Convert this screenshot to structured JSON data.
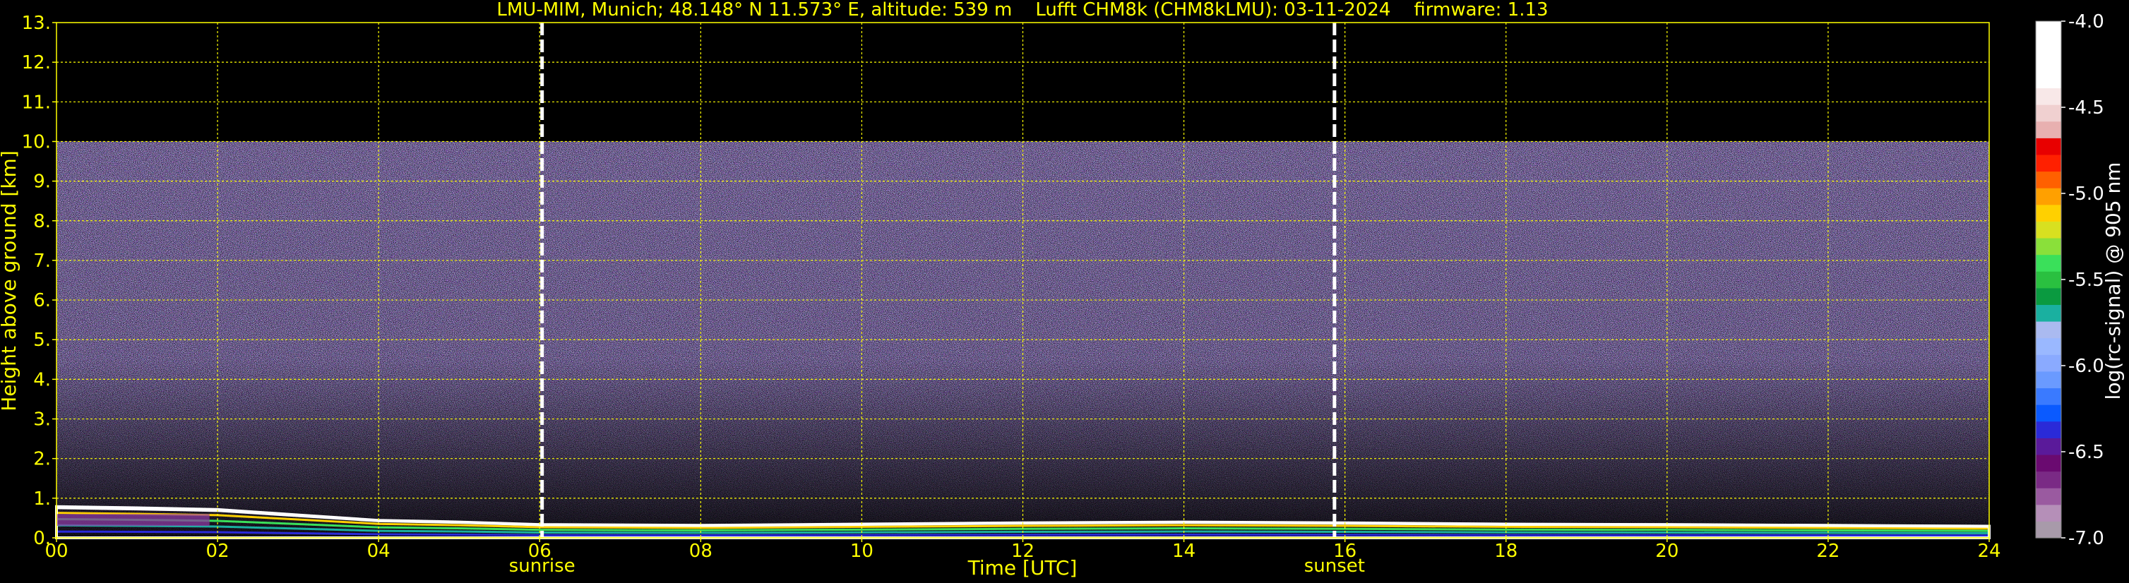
{
  "chart_data": {
    "type": "heatmap",
    "title": "LMU-MIM, Munich; 48.148° N 11.573° E, altitude: 539 m    Lufft CHM8k (CHM8kLMU): 03-11-2024    firmware: 1.13",
    "xlabel": "Time [UTC]",
    "ylabel": "Height above ground [km]",
    "xlim": [
      0,
      24
    ],
    "ylim": [
      0,
      13
    ],
    "x_ticks": [
      "00",
      "02",
      "04",
      "06",
      "08",
      "10",
      "12",
      "14",
      "16",
      "18",
      "20",
      "22",
      "24"
    ],
    "y_ticks": [
      "0.",
      "1.",
      "2.",
      "3.",
      "4.",
      "5.",
      "6.",
      "7.",
      "8.",
      "9.",
      "10.",
      "11.",
      "12.",
      "13."
    ],
    "grid": true,
    "events": [
      {
        "label": "sunrise",
        "time": 6.03
      },
      {
        "label": "sunset",
        "time": 15.87
      }
    ],
    "colorbar": {
      "label": "log(rc-signal) @ 905 nm",
      "range": [
        -7.0,
        -4.0
      ],
      "ticks": [
        "-4.0",
        "-4.5",
        "-5.0",
        "-5.5",
        "-6.0",
        "-6.5",
        "-7.0"
      ],
      "tick_values": [
        -4.0,
        -4.5,
        -5.0,
        -5.5,
        -6.0,
        -6.5,
        -7.0
      ],
      "colors": [
        "#a89aaa",
        "#b58fb8",
        "#9a5aa0",
        "#7a2a85",
        "#6a0a70",
        "#5a1a9a",
        "#2a2ad8",
        "#0a5aff",
        "#3a7aff",
        "#6a9aff",
        "#8aaaff",
        "#9ab8ff",
        "#aabaf0",
        "#1ab0a0",
        "#0a9a40",
        "#2ac040",
        "#3ae05a",
        "#8ae03a",
        "#d8e020",
        "#ffd000",
        "#ffa000",
        "#ff6000",
        "#ff2000",
        "#e80000",
        "#e8b0b0",
        "#f0d0d0",
        "#f8e8e8",
        "#ffffff",
        "#ffffff",
        "#ffffff",
        "#ffffff"
      ]
    },
    "noise_region": {
      "height_top_km": 10.0,
      "color": "#8a76c8"
    },
    "boundary_layer_height_km": [
      {
        "time": 0,
        "height": 0.75
      },
      {
        "time": 1,
        "height": 0.72
      },
      {
        "time": 2,
        "height": 0.68
      },
      {
        "time": 3,
        "height": 0.55
      },
      {
        "time": 4,
        "height": 0.42
      },
      {
        "time": 5,
        "height": 0.38
      },
      {
        "time": 6,
        "height": 0.32
      },
      {
        "time": 8,
        "height": 0.3
      },
      {
        "time": 10,
        "height": 0.33
      },
      {
        "time": 12,
        "height": 0.36
      },
      {
        "time": 14,
        "height": 0.38
      },
      {
        "time": 16,
        "height": 0.36
      },
      {
        "time": 18,
        "height": 0.33
      },
      {
        "time": 20,
        "height": 0.32
      },
      {
        "time": 22,
        "height": 0.3
      },
      {
        "time": 24,
        "height": 0.28
      }
    ]
  }
}
